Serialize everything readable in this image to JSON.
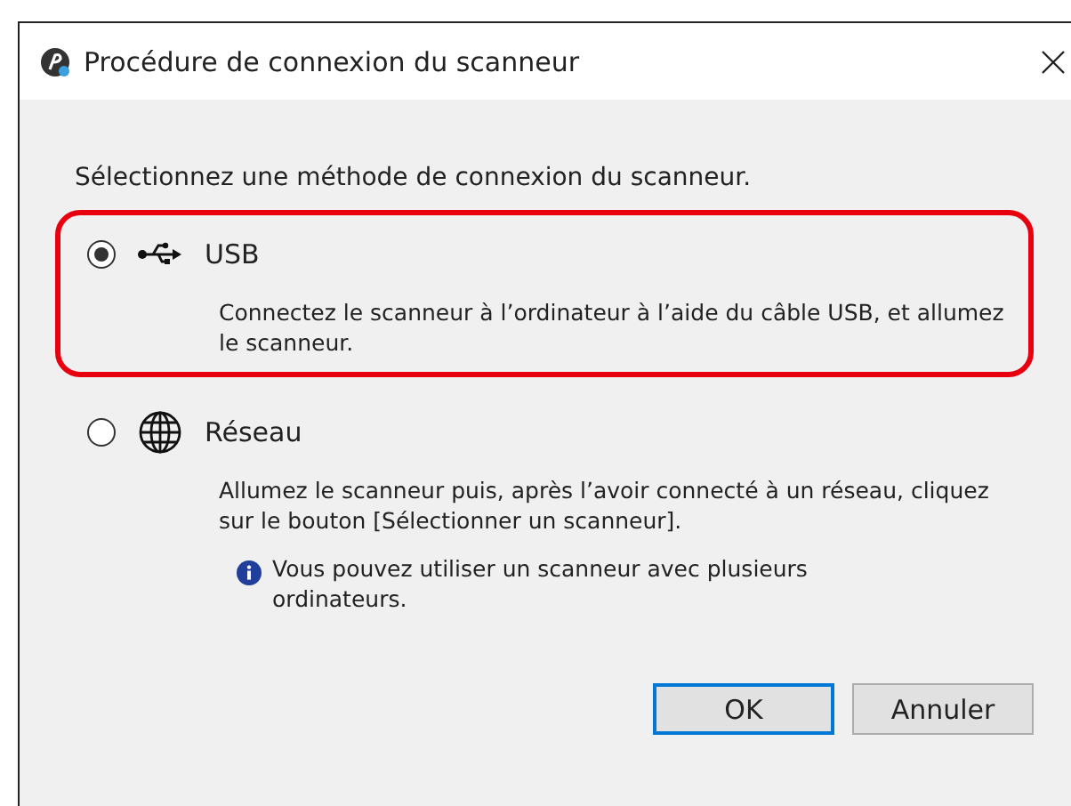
{
  "window": {
    "title": "Procédure de connexion du scanneur"
  },
  "prompt": "Sélectionnez une méthode de connexion du scanneur.",
  "options": [
    {
      "kind": "usb",
      "label": "USB",
      "selected": true,
      "highlighted": true,
      "description": "Connectez le scanneur à l’ordinateur à l’aide du câble USB, et allumez le scanneur."
    },
    {
      "kind": "network",
      "label": "Réseau",
      "selected": false,
      "highlighted": false,
      "description": "Allumez le scanneur puis, après l’avoir connecté à un réseau, cliquez sur le bouton [Sélectionner un scanneur].",
      "note": "Vous pouvez utiliser un scanneur avec plusieurs ordinateurs."
    }
  ],
  "buttons": [
    {
      "label": "OK",
      "default": true
    },
    {
      "label": "Annuler",
      "default": false
    }
  ]
}
